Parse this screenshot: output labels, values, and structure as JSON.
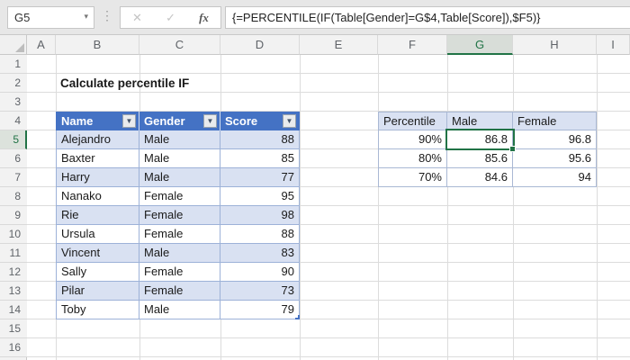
{
  "chrome": {
    "name_box": "G5",
    "formula": "{=PERCENTILE(IF(Table[Gender]=G$4,Table[Score]),$F5)}",
    "cancel_label": "✕",
    "enter_label": "✓",
    "fx_label": "fx",
    "dots": "⋮",
    "dropdown_arrow": "▼"
  },
  "grid": {
    "columns": [
      "A",
      "B",
      "C",
      "D",
      "E",
      "F",
      "G",
      "H",
      "I"
    ],
    "rows": [
      "1",
      "2",
      "3",
      "4",
      "5",
      "6",
      "7",
      "8",
      "9",
      "10",
      "11",
      "12",
      "13",
      "14",
      "15",
      "16"
    ],
    "selected_column": "G",
    "selected_row": "5",
    "selected_cell": "G5",
    "title": "Calculate percentile IF"
  },
  "data_table": {
    "headers": [
      "Name",
      "Gender",
      "Score"
    ],
    "filter_icon": "▼",
    "rows": [
      {
        "name": "Alejandro",
        "gender": "Male",
        "score": "88"
      },
      {
        "name": "Baxter",
        "gender": "Male",
        "score": "85"
      },
      {
        "name": "Harry",
        "gender": "Male",
        "score": "77"
      },
      {
        "name": "Nanako",
        "gender": "Female",
        "score": "95"
      },
      {
        "name": "Rie",
        "gender": "Female",
        "score": "98"
      },
      {
        "name": "Ursula",
        "gender": "Female",
        "score": "88"
      },
      {
        "name": "Vincent",
        "gender": "Male",
        "score": "83"
      },
      {
        "name": "Sally",
        "gender": "Female",
        "score": "90"
      },
      {
        "name": "Pilar",
        "gender": "Female",
        "score": "73"
      },
      {
        "name": "Toby",
        "gender": "Male",
        "score": "79"
      }
    ]
  },
  "percentile_table": {
    "headers": [
      "Percentile",
      "Male",
      "Female"
    ],
    "rows": [
      {
        "percentile": "90%",
        "male": "86.8",
        "female": "96.8"
      },
      {
        "percentile": "80%",
        "male": "85.6",
        "female": "95.6"
      },
      {
        "percentile": "70%",
        "male": "84.6",
        "female": "94"
      }
    ]
  },
  "colors": {
    "excel_green": "#217346",
    "table_header_blue": "#4472C4",
    "banded_row_blue": "#D9E1F2",
    "chrome_gray": "#E7E7E7"
  }
}
